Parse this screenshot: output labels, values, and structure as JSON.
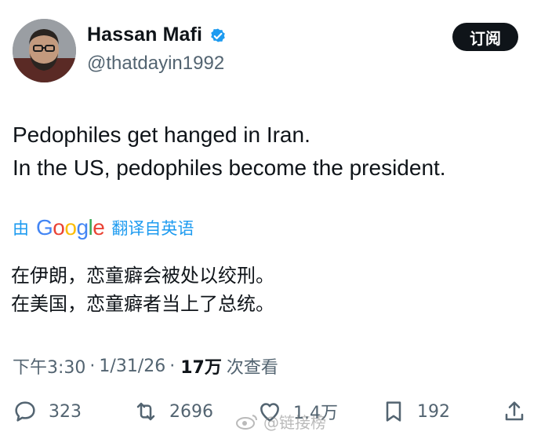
{
  "author": {
    "display_name": "Hassan Mafi",
    "handle": "@thatdayin1992",
    "verified": true,
    "avatar_icon": "person-avatar"
  },
  "subscribe_label": "订阅",
  "tweet": {
    "lines": [
      "Pedophiles get hanged in Iran.",
      "In the US, pedophiles become the president."
    ]
  },
  "translation": {
    "prefix": "由",
    "provider": "Google",
    "suffix": "翻译自英语",
    "lines": [
      "在伊朗，恋童癖会被处以绞刑。",
      "在美国，恋童癖者当上了总统。"
    ]
  },
  "meta": {
    "time": "下午3:30",
    "date": "1/31/26",
    "views": "17万",
    "views_label": "次查看"
  },
  "actions": {
    "replies": "323",
    "reposts": "2696",
    "likes": "1.4万",
    "bookmarks": "192"
  },
  "watermark": {
    "text": "@链接榜"
  },
  "colors": {
    "accent": "#1d9bf0",
    "text": "#0f1419",
    "secondary": "#536471",
    "button_bg": "#0f1419"
  }
}
